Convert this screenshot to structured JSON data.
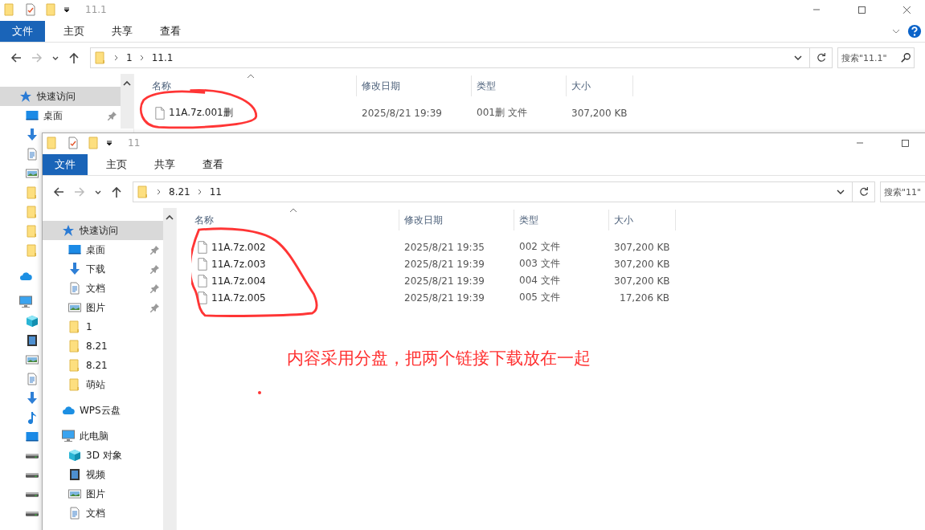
{
  "windows": [
    {
      "title": "11.1",
      "ribbon_tabs": [
        {
          "label": "文件",
          "selected": true
        },
        {
          "label": "主页",
          "selected": false
        },
        {
          "label": "共享",
          "selected": false
        },
        {
          "label": "查看",
          "selected": false
        }
      ],
      "nav": [
        {
          "kind": "back",
          "disabled": false
        },
        {
          "kind": "forward",
          "disabled": true
        },
        {
          "kind": "recent",
          "disabled": false
        },
        {
          "kind": "up",
          "disabled": false
        }
      ],
      "path": [
        "1",
        "11.1"
      ],
      "search": {
        "placeholder": "搜索\"11.1\""
      },
      "sidebar": [
        {
          "label": "快速访问",
          "kind": "quick",
          "selected": true,
          "pinned": false,
          "children": [
            {
              "label": "桌面",
              "kind": "desktop",
              "selected": false,
              "pinned": true
            },
            {
              "kind": "download",
              "selected": false,
              "pinned": false
            },
            {
              "kind": "document",
              "selected": false,
              "pinned": false
            },
            {
              "kind": "pictures",
              "selected": false,
              "pinned": false
            },
            {
              "kind": "folder",
              "selected": false,
              "pinned": false
            },
            {
              "kind": "folder",
              "selected": false,
              "pinned": false
            },
            {
              "kind": "folder",
              "selected": false,
              "pinned": false
            },
            {
              "kind": "folder",
              "selected": false,
              "pinned": false
            }
          ]
        },
        {
          "kind": "cloud",
          "selected": false,
          "pinned": false
        },
        {
          "kind": "pc",
          "selected": false,
          "pinned": false,
          "children": [
            {
              "kind": "cube",
              "selected": false,
              "pinned": false
            },
            {
              "kind": "video",
              "selected": false,
              "pinned": false
            },
            {
              "kind": "pictures",
              "selected": false,
              "pinned": false
            },
            {
              "kind": "document",
              "selected": false,
              "pinned": false
            },
            {
              "kind": "download",
              "selected": false,
              "pinned": false
            },
            {
              "kind": "music",
              "selected": false,
              "pinned": false
            },
            {
              "kind": "desktop",
              "selected": false,
              "pinned": false
            },
            {
              "kind": "drive",
              "selected": false,
              "pinned": false
            },
            {
              "kind": "drive",
              "selected": false,
              "pinned": false
            },
            {
              "kind": "drive",
              "selected": false,
              "pinned": false
            },
            {
              "kind": "drive",
              "selected": false,
              "pinned": false
            }
          ]
        }
      ],
      "columns": [
        "名称",
        "修改日期",
        "类型",
        "大小"
      ],
      "rows": [
        {
          "name": "11A.7z.001删",
          "date": "2025/8/21 19:39",
          "type": "001删 文件",
          "size": "307,200 KB"
        }
      ]
    },
    {
      "title": "11",
      "ribbon_tabs": [
        {
          "label": "文件",
          "selected": true
        },
        {
          "label": "主页",
          "selected": false
        },
        {
          "label": "共享",
          "selected": false
        },
        {
          "label": "查看",
          "selected": false
        }
      ],
      "nav": [
        {
          "kind": "back",
          "disabled": false
        },
        {
          "kind": "forward",
          "disabled": true
        },
        {
          "kind": "recent",
          "disabled": false
        },
        {
          "kind": "up",
          "disabled": false
        }
      ],
      "path": [
        "8.21",
        "11"
      ],
      "search": {
        "placeholder": "搜索\"11\""
      },
      "sidebar": [
        {
          "label": "快速访问",
          "kind": "quick",
          "selected": true,
          "pinned": false,
          "children": [
            {
              "label": "桌面",
              "kind": "desktop",
              "selected": false,
              "pinned": true
            },
            {
              "label": "下载",
              "kind": "download",
              "selected": false,
              "pinned": true
            },
            {
              "label": "文档",
              "kind": "document",
              "selected": false,
              "pinned": true
            },
            {
              "label": "图片",
              "kind": "pictures",
              "selected": false,
              "pinned": true
            },
            {
              "label": "1",
              "kind": "folder",
              "selected": false,
              "pinned": false
            },
            {
              "label": "8.21",
              "kind": "folder",
              "selected": false,
              "pinned": false
            },
            {
              "label": "8.21",
              "kind": "folder",
              "selected": false,
              "pinned": false
            },
            {
              "label": "萌站",
              "kind": "folder",
              "selected": false,
              "pinned": false
            }
          ]
        },
        {
          "label": "WPS云盘",
          "kind": "cloud",
          "selected": false,
          "pinned": false
        },
        {
          "label": "此电脑",
          "kind": "pc",
          "selected": false,
          "pinned": false,
          "children": [
            {
              "label": "3D 对象",
              "kind": "cube",
              "selected": false,
              "pinned": false
            },
            {
              "label": "视频",
              "kind": "video",
              "selected": false,
              "pinned": false
            },
            {
              "label": "图片",
              "kind": "pictures",
              "selected": false,
              "pinned": false
            },
            {
              "label": "文档",
              "kind": "document",
              "selected": false,
              "pinned": false
            }
          ]
        }
      ],
      "columns": [
        "名称",
        "修改日期",
        "类型",
        "大小"
      ],
      "rows": [
        {
          "name": "11A.7z.002",
          "date": "2025/8/21 19:35",
          "type": "002 文件",
          "size": "307,200 KB"
        },
        {
          "name": "11A.7z.003",
          "date": "2025/8/21 19:39",
          "type": "003 文件",
          "size": "307,200 KB"
        },
        {
          "name": "11A.7z.004",
          "date": "2025/8/21 19:39",
          "type": "004 文件",
          "size": "307,200 KB"
        },
        {
          "name": "11A.7z.005",
          "date": "2025/8/21 19:39",
          "type": "005 文件",
          "size": "17,206 KB"
        }
      ]
    }
  ],
  "annotation": {
    "note": "内容采用分盘，把两个链接下载放在一起"
  }
}
